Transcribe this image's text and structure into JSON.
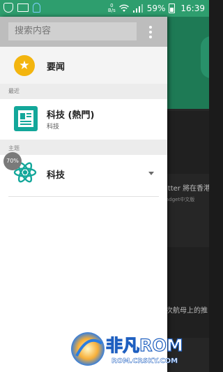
{
  "status_bar": {
    "speed_value": "0",
    "speed_unit": "B/s",
    "battery": "59%",
    "time": "16:39",
    "icons": [
      "shield-icon",
      "image-icon",
      "notification-icon",
      "wifi-icon",
      "signal-icon",
      "battery-icon"
    ]
  },
  "drawer": {
    "search": {
      "placeholder": "搜索内容"
    },
    "headline": {
      "label": "要闻",
      "icon": "star-icon",
      "icon_color": "#f3b50f"
    },
    "recent": {
      "header": "最近",
      "items": [
        {
          "title": "科技 (熱門)",
          "subtitle": "科技",
          "icon": "document-icon",
          "icon_color": "#13a79a"
        }
      ]
    },
    "topics": {
      "header": "主题",
      "items": [
        {
          "label": "科技",
          "icon": "atom-icon",
          "icon_color": "#13a79a",
          "expandable": true
        }
      ]
    }
  },
  "overlay": {
    "progress": "70%"
  },
  "background_app": {
    "text_1": "itter 將在香港",
    "text_2": "adget中文版",
    "text_3": "次航母上的推",
    "accent": "#1e7a55"
  },
  "watermark": {
    "title": "非凡ROM",
    "url": "ROM.CRSKY.COM"
  }
}
